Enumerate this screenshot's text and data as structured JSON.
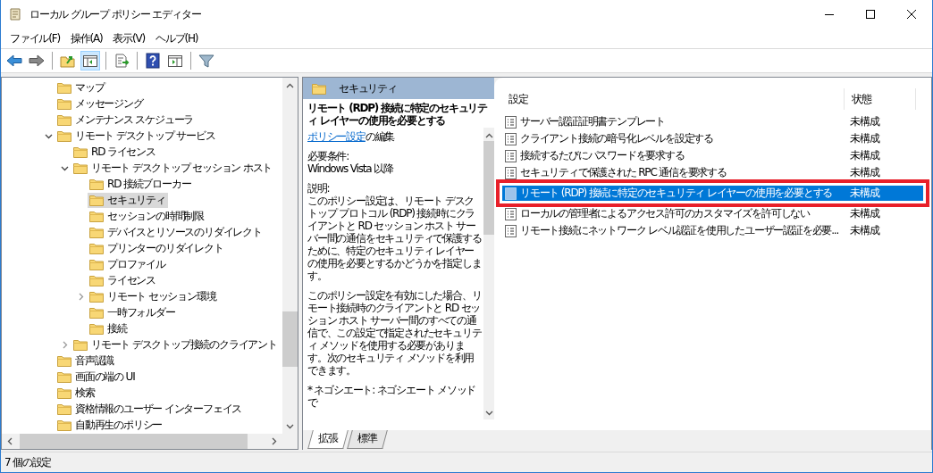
{
  "window": {
    "title": "ローカル グループ ポリシー エディター"
  },
  "menu": [
    "ファイル(F)",
    "操作(A)",
    "表示(V)",
    "ヘルプ(H)"
  ],
  "toolbar": [
    [
      {
        "kind": "back",
        "pressed": false
      },
      {
        "kind": "forward",
        "pressed": false
      }
    ],
    [
      {
        "kind": "up",
        "pressed": false
      },
      {
        "kind": "tree",
        "pressed": true
      }
    ],
    [
      {
        "kind": "export",
        "pressed": false
      }
    ],
    [
      {
        "kind": "help",
        "pressed": false
      },
      {
        "kind": "pane",
        "pressed": false
      }
    ],
    [
      {
        "kind": "filter",
        "pressed": false
      }
    ]
  ],
  "tree": [
    {
      "label": "マップ",
      "selected": false
    },
    {
      "label": "メッセージング",
      "selected": false
    },
    {
      "label": "メンテナンス スケジューラ",
      "selected": false
    },
    {
      "label": "リモート デスクトップ サービス",
      "selected": false,
      "expanded": true,
      "children": [
        {
          "label": "RD ライセンス",
          "selected": false
        },
        {
          "label": "リモート デスクトップ セッション ホスト",
          "selected": false,
          "expanded": true,
          "children": [
            {
              "label": "RD 接続ブローカー",
              "selected": false
            },
            {
              "label": "セキュリティ",
              "selected": true
            },
            {
              "label": "セッションの時間制限",
              "selected": false
            },
            {
              "label": "デバイスとリソースのリダイレクト",
              "selected": false
            },
            {
              "label": "プリンターのリダイレクト",
              "selected": false
            },
            {
              "label": "プロファイル",
              "selected": false
            },
            {
              "label": "ライセンス",
              "selected": false
            },
            {
              "label": "リモート セッション環境",
              "selected": false,
              "expanded": false
            },
            {
              "label": "一時フォルダー",
              "selected": false
            },
            {
              "label": "接続",
              "selected": false
            }
          ]
        },
        {
          "label": "リモート デスクトップ接続のクライアント",
          "selected": false,
          "expanded": false
        }
      ]
    },
    {
      "label": "音声認識",
      "selected": false
    },
    {
      "label": "画面の端の UI",
      "selected": false
    },
    {
      "label": "検索",
      "selected": false
    },
    {
      "label": "資格情報のユーザー インターフェイス",
      "selected": false
    },
    {
      "label": "自動再生のポリシー",
      "selected": false
    }
  ],
  "description": {
    "header": "セキュリティ",
    "title": "リモート (RDP) 接続に特定のセキュリティ レイヤーの使用を必要とする",
    "link": "ポリシー設定",
    "link_suffix": "の編集",
    "requirements_label": "必要条件:",
    "requirements": "Windows Vista 以降",
    "explanation_label": "説明:",
    "paragraphs": [
      "このポリシー設定は、リモート デスクトップ プロトコル (RDP) 接続時にクライアントと RD セッション ホスト サーバー間の通信をセキュリティで保護するために、特定のセキュリティ レイヤーの使用を必要とするかどうかを指定します。",
      "このポリシー設定を有効にした場合、リモート接続時のクライアントと RD セッション ホスト サーバー間のすべての通信で、この設定で指定されたセキュリティ メソッドを使用する必要があります。次のセキュリティ メソッドを利用できます。",
      "* ネゴシエート: ネゴシエート メソッドで"
    ]
  },
  "table": {
    "columns": [
      "設定",
      "状態"
    ],
    "rows": [
      {
        "name": "サーバー認証証明書テンプレート",
        "state": "未構成",
        "selected": false,
        "annotated": false
      },
      {
        "name": "クライアント接続の暗号化レベルを設定する",
        "state": "未構成",
        "selected": false,
        "annotated": false
      },
      {
        "name": "接続するたびにパスワードを要求する",
        "state": "未構成",
        "selected": false,
        "annotated": false
      },
      {
        "name": "セキュリティで保護された RPC 通信を要求する",
        "state": "未構成",
        "selected": false,
        "annotated": false
      },
      {
        "name": "リモート (RDP) 接続に特定のセキュリティ レイヤーの使用を必要とする",
        "state": "未構成",
        "selected": true,
        "annotated": true
      },
      {
        "name": "ローカルの管理者によるアクセス許可のカスタマイズを許可しない",
        "state": "未構成",
        "selected": false,
        "annotated": false
      },
      {
        "name": "リモート接続にネットワーク レベル認証を使用したユーザー認証を必要...",
        "state": "未構成",
        "selected": false,
        "annotated": false
      }
    ]
  },
  "tabs": [
    {
      "label": "拡張",
      "selected": true
    },
    {
      "label": "標準",
      "selected": false
    }
  ],
  "status_bar": "7 個の設定"
}
